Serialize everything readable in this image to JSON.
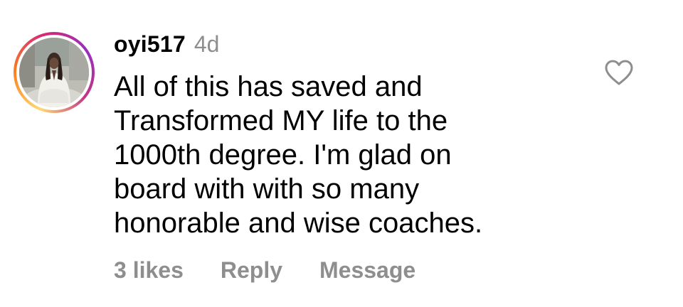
{
  "comment": {
    "username": "oyi517",
    "timestamp": "4d",
    "text_lines": [
      "All of this has saved and",
      "Transformed MY life to the",
      "1000th degree. I'm glad on",
      "board with with so many",
      "honorable and wise coaches."
    ],
    "likes": "3 likes",
    "reply_label": "Reply",
    "message_label": "Message",
    "avatar_icon": "profile-photo",
    "like_icon": "heart-outline-icon"
  },
  "colors": {
    "text": "#000000",
    "muted": "#8e8e8e",
    "ring_gradient": [
      "#feda75",
      "#fa7e1e",
      "#d62976",
      "#962fbf"
    ]
  }
}
